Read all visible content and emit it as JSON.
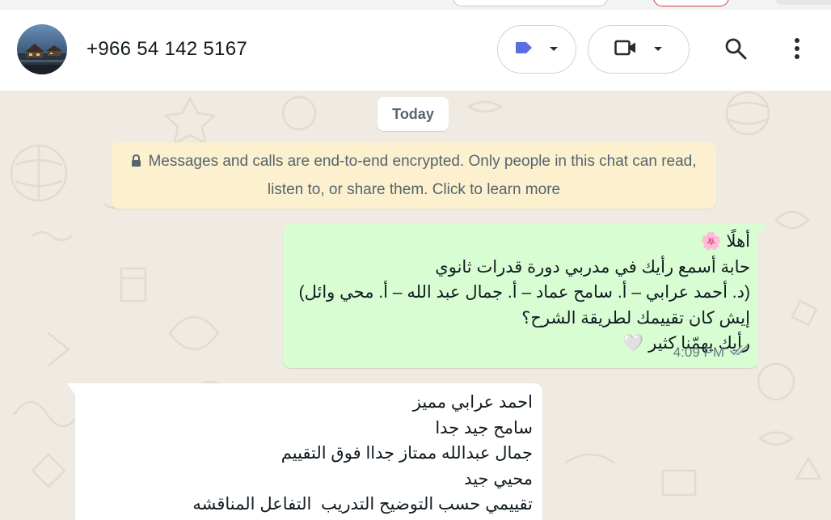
{
  "header": {
    "contact_name": "+966 54 142 5167",
    "icons": {
      "label": "label-icon",
      "video": "video-camera-icon",
      "search": "search-icon",
      "menu": "more-vertical-icon"
    }
  },
  "chat": {
    "date_chip": "Today",
    "encryption_notice": "Messages and calls are end-to-end encrypted. Only people in this chat can read, listen to, or share them. Click to learn more",
    "messages": [
      {
        "direction": "outgoing",
        "text": "أهلًا 🌸\nحابة أسمع رأيك في مدربي دورة قدرات ثانوي\n(د. أحمد عرابي – أ. سامح عماد – أ. جمال عبد الله – أ. محي وائل)\nإيش كان تقييمك لطريقة الشرح؟\nرأيك يهمّنا كثير 🤍",
        "time": "4:09 PM",
        "status": "read"
      },
      {
        "direction": "incoming",
        "text": "احمد عرابي مميز\nسامح جيد جدا\nجمال عبدالله ممتاز جداا فوق التقييم\nمحيي جيد\nتقييمي حسب التوضيح التدريب  التفاعل المناقشه"
      }
    ]
  },
  "colors": {
    "chat_bg": "#efeae2",
    "outgoing_bubble": "#d9fdd3",
    "incoming_bubble": "#ffffff",
    "notice_bg": "#fdf0cf",
    "label_accent": "#5b6ee1",
    "read_ticks": "#8696a0"
  }
}
